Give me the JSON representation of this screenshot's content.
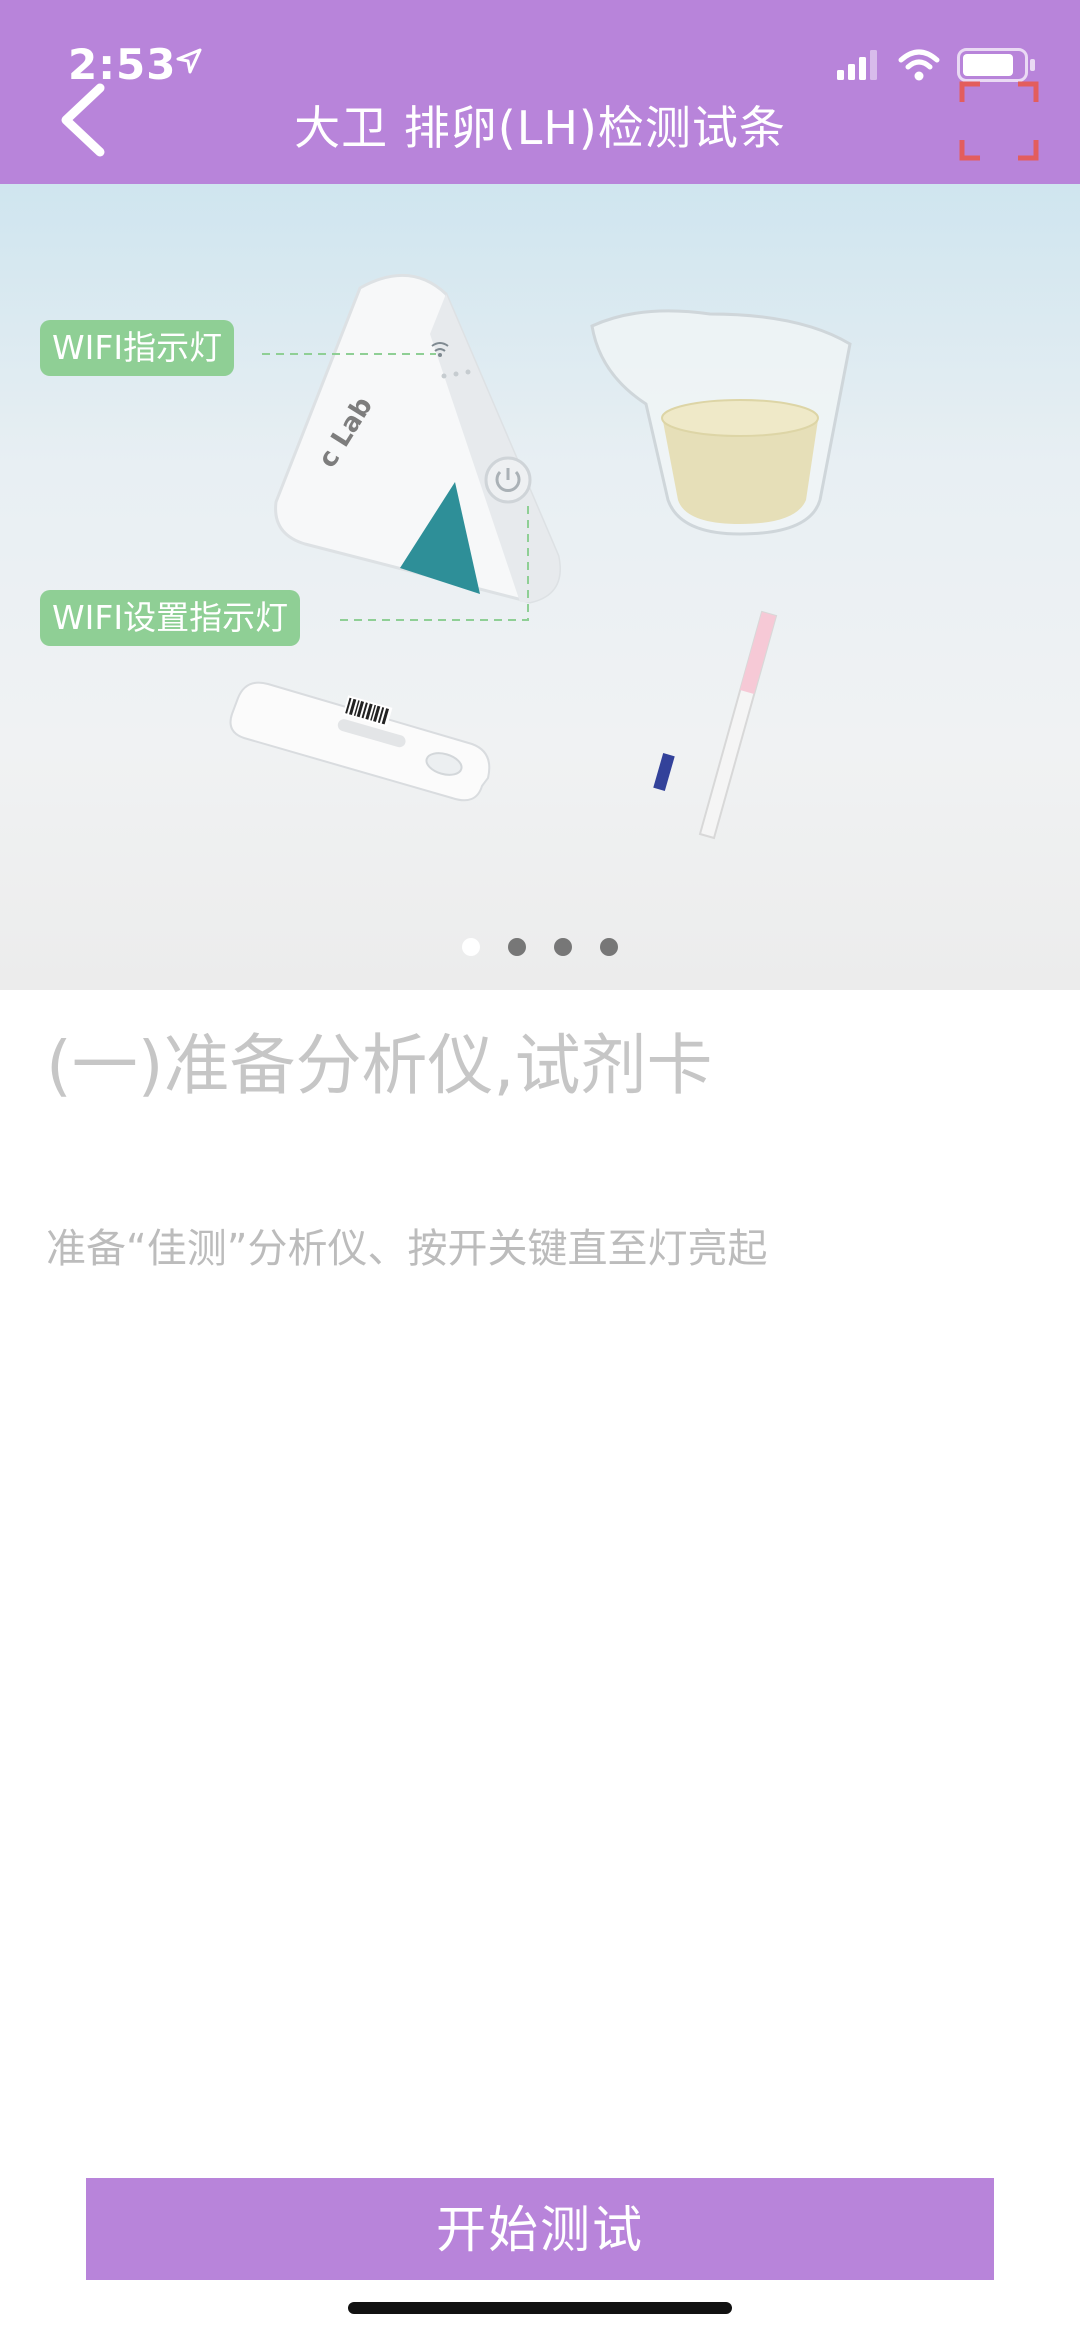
{
  "status_bar": {
    "time": "2:53"
  },
  "header": {
    "title": "大卫 排卵(LH)检测试条",
    "background": "#b884da",
    "scan_icon_color": "#e35d5d"
  },
  "banner": {
    "device_logo": "c Lab",
    "callouts": {
      "wifi_indicator": "WIFI指示灯",
      "wifi_setup_indicator": "WIFI设置指示灯"
    },
    "page_count": 4,
    "active_page": 1,
    "callout_color": "#8fcf95"
  },
  "content": {
    "step_title": "(一)准备分析仪,试剂卡",
    "step_desc": "准备“佳测”分析仪、按开关键直至灯亮起"
  },
  "footer": {
    "start_button": "开始测试",
    "button_color": "#b884da"
  }
}
